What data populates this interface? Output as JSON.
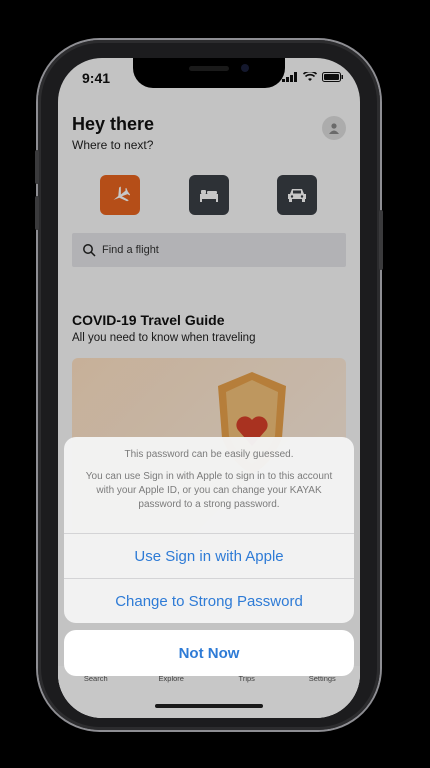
{
  "status_bar": {
    "time": "9:41"
  },
  "header": {
    "greeting": "Hey there",
    "subtitle": "Where to next?"
  },
  "categories": [
    {
      "icon": "airplane-icon",
      "color": "#e8651f"
    },
    {
      "icon": "bed-icon",
      "color": "#3a3f46"
    },
    {
      "icon": "car-icon",
      "color": "#3a3f46"
    }
  ],
  "search": {
    "placeholder": "Find a flight"
  },
  "covid": {
    "title": "COVID-19 Travel Guide",
    "subtitle": "All you need to know when traveling"
  },
  "tabs": [
    {
      "label": "Search",
      "active": true
    },
    {
      "label": "Explore",
      "active": false
    },
    {
      "label": "Trips",
      "active": false
    },
    {
      "label": "Settings",
      "active": false
    }
  ],
  "action_sheet": {
    "title": "This password can be easily guessed.",
    "message": "You can use Sign in with Apple to sign in to this account with your Apple ID, or you can change your KAYAK password to a strong password.",
    "apple_button": "Use Sign in with Apple",
    "change_button": "Change to Strong Password",
    "cancel_button": "Not Now"
  },
  "colors": {
    "accent": "#2e7bd6",
    "brand_orange": "#e8651f"
  }
}
